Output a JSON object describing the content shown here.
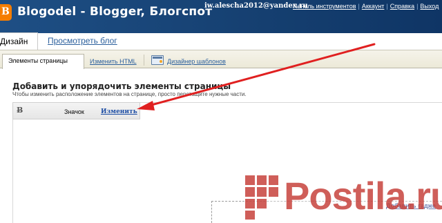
{
  "header": {
    "blog_title": "Blogodel - Blogger, Блогспот",
    "user_email": "iw.alescha2012@yandex.ru",
    "links": [
      "Панель инструментов",
      "Аккаунт",
      "Справка",
      "Выход"
    ],
    "tabs": {
      "design": "Дизайн",
      "view_blog": "Просмотреть блог"
    }
  },
  "subtabs": {
    "page_elements": "Элементы страницы",
    "edit_html": "Изменить HTML",
    "template_designer": "Дизайнер шаблонов"
  },
  "main": {
    "heading": "Добавить и упорядочить элементы страницы",
    "hint": "Чтобы изменить расположение элементов на странице, просто перетащите нужные части.",
    "gadget": {
      "label": "Значок",
      "edit_link": "Изменить"
    },
    "add_gadget_link": "Добавить гадже"
  },
  "watermark": {
    "text": "Postila.ru"
  },
  "colors": {
    "header_blue": "#1e4f85",
    "blogger_orange": "#f57d00",
    "link_blue": "#2b5f9c",
    "arrow_red": "#e02020",
    "watermark_red": "#c43a34"
  },
  "icons": [
    "blogger-logo-icon",
    "template-designer-icon",
    "favicon-gadget-icon",
    "red-arrow-annotation",
    "postila-logo-icon"
  ]
}
